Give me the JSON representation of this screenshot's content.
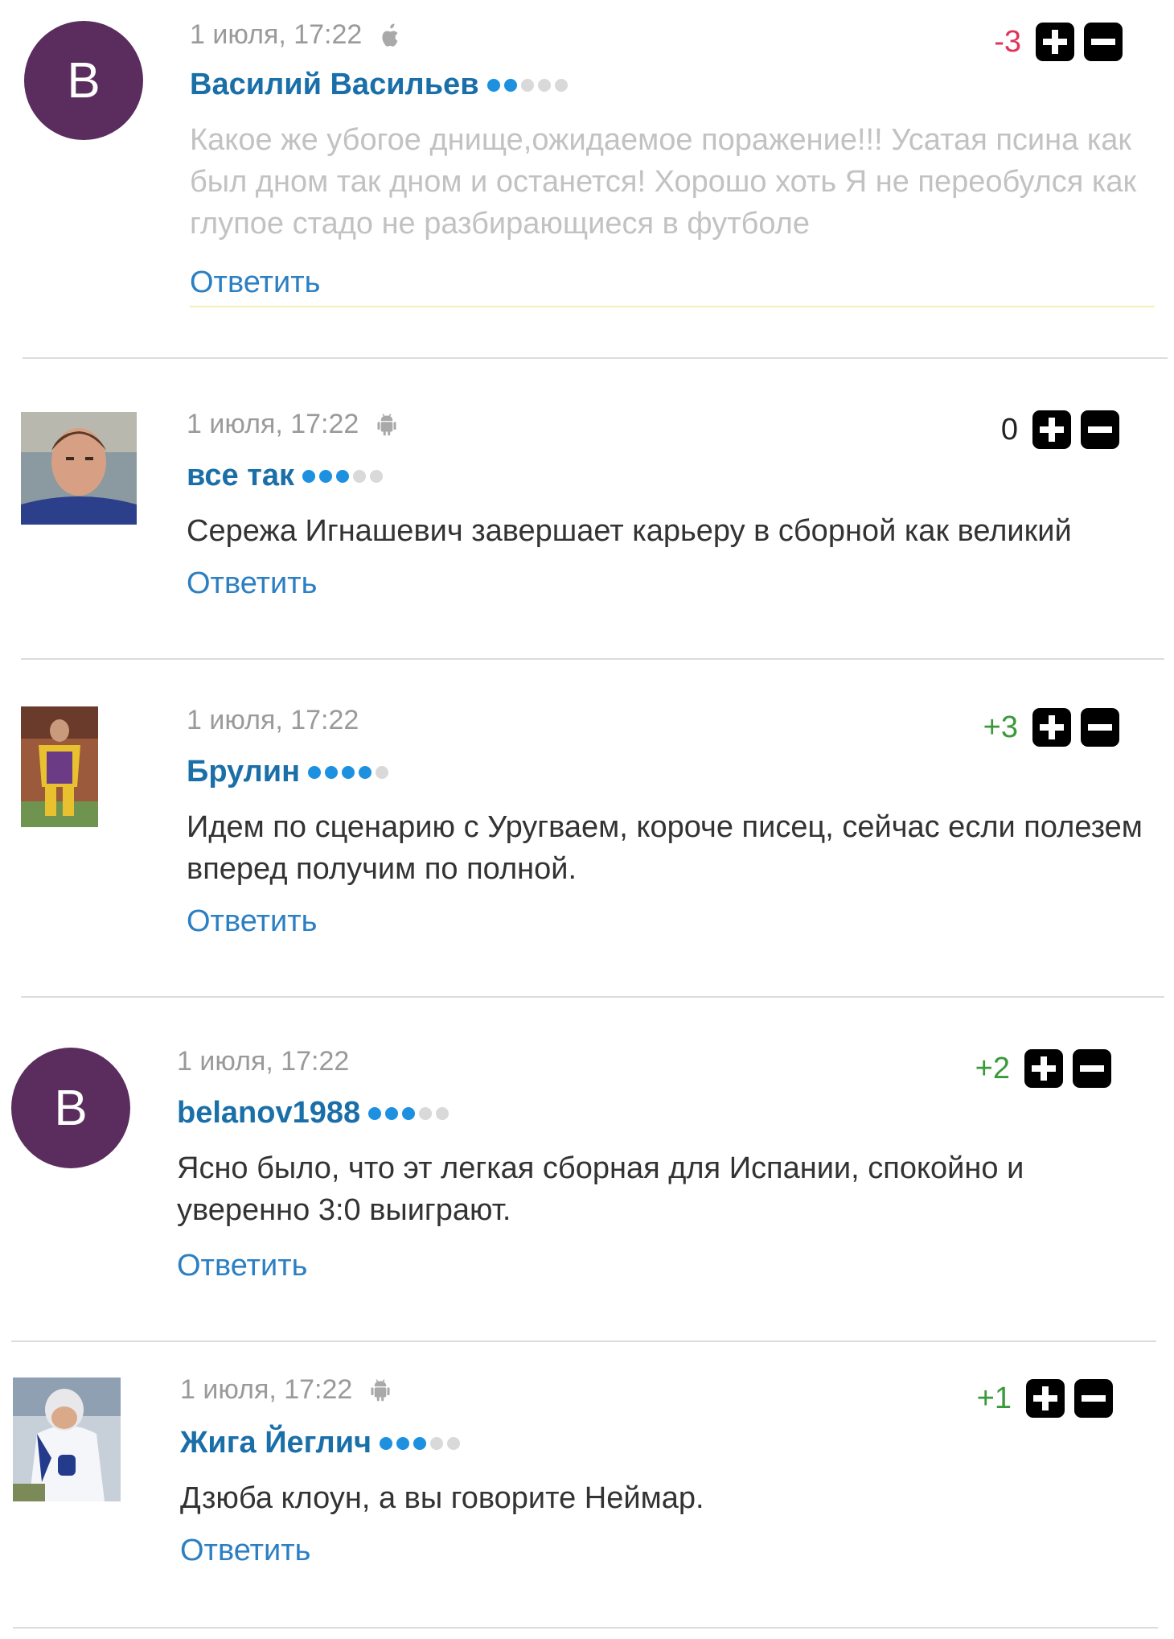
{
  "reply_label": "Ответить",
  "colors": {
    "author": "#1a6fa8",
    "reply": "#2b7fc2",
    "score_negative": "#e0335a",
    "score_positive": "#3a9a3a",
    "score_neutral": "#222222",
    "rank_dot_on": "#1e90e0",
    "rank_dot_off": "#d9d9d9",
    "avatar_letter_bg": "#5a2d5e"
  },
  "comments": [
    {
      "avatar_type": "letter",
      "avatar_letter": "В",
      "timestamp": "1 июля, 17:22",
      "platform_icon": "apple-icon",
      "author": "Василий Васильев",
      "rank_filled": 2,
      "rank_total": 5,
      "score": "-3",
      "score_tone": "negative",
      "text": "Какое же убогое днище,ожидаемое поражение!!! Усатая псина как был дном так дном и останется! Хорошо хоть Я не переобулся как глупое стадо не разбирающиеся в футболе",
      "faded": true
    },
    {
      "avatar_type": "photo",
      "avatar_photo": "goalkeeper-photo",
      "timestamp": "1 июля, 17:22",
      "platform_icon": "android-icon",
      "author": "все так",
      "rank_filled": 3,
      "rank_total": 5,
      "score": "0",
      "score_tone": "neutral",
      "text": "Сережа Игнашевич завершает карьеру в сборной как великий",
      "faded": false
    },
    {
      "avatar_type": "photo",
      "avatar_photo": "footballer-photo",
      "timestamp": "1 июля, 17:22",
      "platform_icon": "",
      "author": "Брулин",
      "rank_filled": 4,
      "rank_total": 5,
      "score": "+3",
      "score_tone": "positive",
      "text": "Идем по сценарию с Уругваем, короче писец, сейчас если полезем вперед получим по полной.",
      "faded": false
    },
    {
      "avatar_type": "letter",
      "avatar_letter": "В",
      "timestamp": "1 июля, 17:22",
      "platform_icon": "",
      "author": "belanov1988",
      "rank_filled": 3,
      "rank_total": 5,
      "score": "+2",
      "score_tone": "positive",
      "text": "Ясно было, что эт легкая сборная для Испании, спокойно и уверенно 3:0 выиграют.",
      "faded": false
    },
    {
      "avatar_type": "photo",
      "avatar_photo": "hockey-player-photo",
      "timestamp": "1 июля, 17:22",
      "platform_icon": "android-icon",
      "author": "Жига Йеглич",
      "rank_filled": 3,
      "rank_total": 5,
      "score": "+1",
      "score_tone": "positive",
      "text": "Дзюба клоун, а вы говорите Неймар.",
      "faded": false
    }
  ]
}
